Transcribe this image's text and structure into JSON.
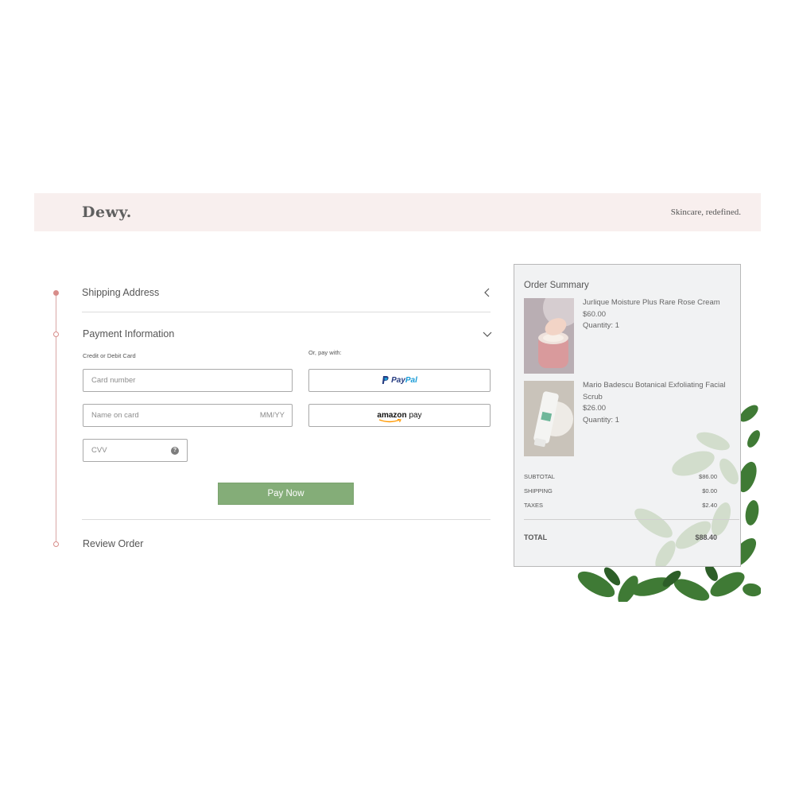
{
  "header": {
    "logo": "Dewy.",
    "tagline": "Skincare, redefined."
  },
  "steps": {
    "shipping_title": "Shipping Address",
    "payment_title": "Payment Information",
    "review_title": "Review Order"
  },
  "payment": {
    "card_label": "Credit or Debit Card",
    "alt_label": "Or, pay with:",
    "card_number_placeholder": "Card number",
    "name_placeholder": "Name on card",
    "expiry_placeholder": "MM/YY",
    "cvv_placeholder": "CVV",
    "help_glyph": "?",
    "paypal_part1": "Pay",
    "paypal_part2": "Pal",
    "amazon_part1": "amazon",
    "amazon_part2": "pay",
    "pay_now_label": "Pay Now"
  },
  "summary": {
    "title": "Order Summary",
    "items": [
      {
        "name": "Jurlique Moisture Plus Rare Rose Cream",
        "price": "$60.00",
        "quantity": "Quantity: 1"
      },
      {
        "name": "Mario Badescu Botanical Exfoliating Facial Scrub",
        "price": "$26.00",
        "quantity": "Quantity: 1"
      }
    ],
    "subtotal_label": "SUBTOTAL",
    "subtotal_value": "$86.00",
    "shipping_label": "SHIPPING",
    "shipping_value": "$0.00",
    "taxes_label": "TAXES",
    "taxes_value": "$2.40",
    "total_label": "TOTAL",
    "total_value": "$88.40"
  },
  "colors": {
    "header_bg": "#f8efee",
    "accent_rose": "#d88d8a",
    "pay_now_green": "#84ad78",
    "summary_bg": "#f1f2f3"
  }
}
